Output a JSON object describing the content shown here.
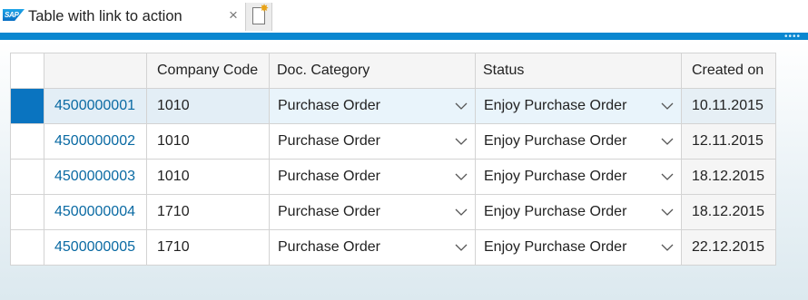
{
  "tab": {
    "title": "Table with link to action",
    "close": "×"
  },
  "table": {
    "headers": {
      "doc": "",
      "company_code": "Company Code",
      "doc_category": "Doc. Category",
      "status": "Status",
      "created_on": "Created on"
    },
    "rows": [
      {
        "doc": "4500000001",
        "company_code": "1010",
        "doc_category": "Purchase Order",
        "status": "Enjoy Purchase Order",
        "created_on": "10.11.2015",
        "selected": true
      },
      {
        "doc": "4500000002",
        "company_code": "1010",
        "doc_category": "Purchase Order",
        "status": "Enjoy Purchase Order",
        "created_on": "12.11.2015",
        "selected": false
      },
      {
        "doc": "4500000003",
        "company_code": "1010",
        "doc_category": "Purchase Order",
        "status": "Enjoy Purchase Order",
        "created_on": "18.12.2015",
        "selected": false
      },
      {
        "doc": "4500000004",
        "company_code": "1710",
        "doc_category": "Purchase Order",
        "status": "Enjoy Purchase Order",
        "created_on": "18.12.2015",
        "selected": false
      },
      {
        "doc": "4500000005",
        "company_code": "1710",
        "doc_category": "Purchase Order",
        "status": "Enjoy Purchase Order",
        "created_on": "22.12.2015",
        "selected": false
      }
    ]
  },
  "colors": {
    "accent": "#0a87d0",
    "selection": "#0a74c0",
    "link": "#0a6aa3"
  },
  "icons": {
    "logo": "sap-logo",
    "close": "close-icon",
    "new_tab": "new-document-icon",
    "dropdown": "chevron-down-icon"
  }
}
